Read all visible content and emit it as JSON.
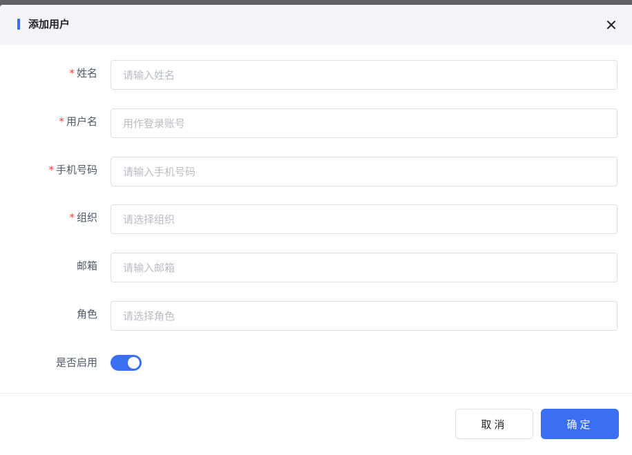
{
  "dialog": {
    "title": "添加用户",
    "close_icon": "close-icon"
  },
  "form": {
    "fields": [
      {
        "label": "姓名",
        "required": true,
        "placeholder": "请输入姓名",
        "value": ""
      },
      {
        "label": "用户名",
        "required": true,
        "placeholder": "用作登录账号",
        "value": ""
      },
      {
        "label": "手机号码",
        "required": true,
        "placeholder": "请输入手机号码",
        "value": ""
      },
      {
        "label": "组织",
        "required": true,
        "placeholder": "请选择组织",
        "value": ""
      },
      {
        "label": "邮箱",
        "required": false,
        "placeholder": "请输入邮箱",
        "value": ""
      },
      {
        "label": "角色",
        "required": false,
        "placeholder": "请选择角色",
        "value": ""
      }
    ],
    "enabled": {
      "label": "是否启用",
      "on": true
    }
  },
  "footer": {
    "cancel_label": "取消",
    "confirm_label": "确定"
  },
  "colors": {
    "accent": "#3a6ff2",
    "required": "#f53f3f"
  }
}
